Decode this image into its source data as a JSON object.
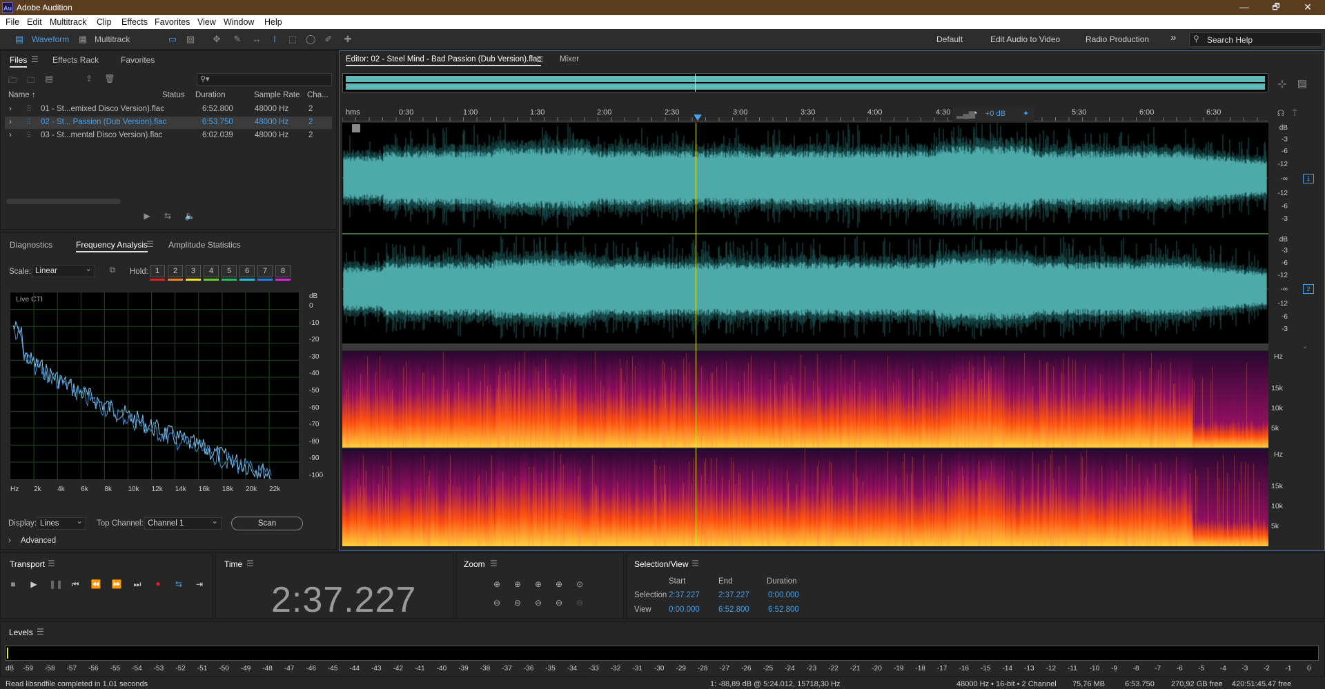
{
  "app": {
    "title": "Adobe Audition",
    "icon_text": "Au"
  },
  "window_controls": {
    "minimize": "—",
    "maximize": "🗗",
    "close": "✕"
  },
  "menu": [
    "File",
    "Edit",
    "Multitrack",
    "Clip",
    "Effects",
    "Favorites",
    "View",
    "Window",
    "Help"
  ],
  "toolbar": {
    "waveform_label": "Waveform",
    "multitrack_label": "Multitrack",
    "workspaces": [
      "Default",
      "Edit Audio to Video",
      "Radio Production"
    ],
    "more": "»",
    "search_placeholder": "Search Help"
  },
  "files_panel": {
    "tabs": [
      "Files",
      "Effects Rack",
      "Favorites"
    ],
    "columns": [
      "Name ↑",
      "Status",
      "Duration",
      "Sample Rate",
      "Cha..."
    ],
    "rows": [
      {
        "name": "01 - St...emixed Disco Version).flac",
        "status": "",
        "duration": "6:52.800",
        "rate": "48000 Hz",
        "ch": "2"
      },
      {
        "name": "02 - St... Passion (Dub Version).flac",
        "status": "",
        "duration": "6:53.750",
        "rate": "48000 Hz",
        "ch": "2"
      },
      {
        "name": "03 - St...mental Disco Version).flac",
        "status": "",
        "duration": "6:02.039",
        "rate": "48000 Hz",
        "ch": "2"
      }
    ],
    "search_icon": "⚲▾"
  },
  "analysis_panel": {
    "tabs": [
      "Diagnostics",
      "Frequency Analysis",
      "Amplitude Statistics"
    ],
    "scale_label": "Scale:",
    "scale_value": "Linear",
    "hold_label": "Hold:",
    "holds": [
      "1",
      "2",
      "3",
      "4",
      "5",
      "6",
      "7",
      "8"
    ],
    "hold_colors": [
      "#e02020",
      "#f08020",
      "#f0e020",
      "#60d020",
      "#20c060",
      "#20c0e0",
      "#2080f0",
      "#e020e0"
    ],
    "live_label": "Live CTI",
    "db_unit": "dB",
    "db_ticks": [
      "0",
      "-10",
      "-20",
      "-30",
      "-40",
      "-50",
      "-60",
      "-70",
      "-80",
      "-90",
      "-100"
    ],
    "hz_ticks": [
      "Hz",
      "2k",
      "4k",
      "6k",
      "8k",
      "10k",
      "12k",
      "14k",
      "16k",
      "18k",
      "20k",
      "22k"
    ],
    "display_label": "Display:",
    "display_value": "Lines",
    "top_channel_label": "Top Channel:",
    "top_channel_value": "Channel 1",
    "scan_label": "Scan",
    "advanced_label": "Advanced"
  },
  "editor": {
    "tab": "Editor: 02 - Steel Mind - Bad Passion (Dub Version).flac",
    "mixer_tab": "Mixer",
    "ruler": [
      "hms",
      "0:30",
      "1:00",
      "1:30",
      "2:00",
      "2:30",
      "3:00",
      "3:30",
      "4:00",
      "4:30",
      "5:30",
      "6:00",
      "6:30"
    ],
    "hud_gain": "+0 dB",
    "channel1": {
      "db_labels": [
        "dB",
        "-3",
        "-6",
        "-12",
        "-∞",
        "-12",
        "-6",
        "-3"
      ],
      "num": "1"
    },
    "channel2": {
      "db_labels": [
        "dB",
        "-3",
        "-6",
        "-12",
        "-∞",
        "-12",
        "-6",
        "-3"
      ],
      "num": "2"
    },
    "spec_labels": [
      "Hz",
      "15k",
      "10k",
      "5k"
    ]
  },
  "transport": {
    "title": "Transport"
  },
  "time": {
    "title": "Time",
    "value": "2:37.227"
  },
  "zoom": {
    "title": "Zoom"
  },
  "selection": {
    "title": "Selection/View",
    "headers": [
      "Start",
      "End",
      "Duration"
    ],
    "selection_label": "Selection",
    "view_label": "View",
    "selection_vals": [
      "2:37.227",
      "2:37.227",
      "0:00.000"
    ],
    "view_vals": [
      "0:00.000",
      "6:52.800",
      "6:52.800"
    ]
  },
  "levels": {
    "title": "Levels",
    "ticks": [
      "dB",
      "-59",
      "-58",
      "-57",
      "-56",
      "-55",
      "-54",
      "-53",
      "-52",
      "-51",
      "-50",
      "-49",
      "-48",
      "-47",
      "-46",
      "-45",
      "-44",
      "-43",
      "-42",
      "-41",
      "-40",
      "-39",
      "-38",
      "-37",
      "-36",
      "-35",
      "-34",
      "-33",
      "-32",
      "-31",
      "-30",
      "-29",
      "-28",
      "-27",
      "-26",
      "-25",
      "-24",
      "-23",
      "-22",
      "-21",
      "-20",
      "-19",
      "-18",
      "-17",
      "-16",
      "-15",
      "-14",
      "-13",
      "-12",
      "-11",
      "-10",
      "-9",
      "-8",
      "-7",
      "-6",
      "-5",
      "-4",
      "-3",
      "-2",
      "-1",
      "0"
    ]
  },
  "status": {
    "left": "Read libsndfile completed in 1,01 seconds",
    "cursor": "1: -88,89 dB @ 5:24.012, 15718,30 Hz",
    "format": "48000 Hz • 16-bit • 2 Channel",
    "size": "75,76 MB",
    "duration": "6:53.750",
    "free": "270,92 GB free",
    "time_free": "420:51:45.47 free"
  }
}
